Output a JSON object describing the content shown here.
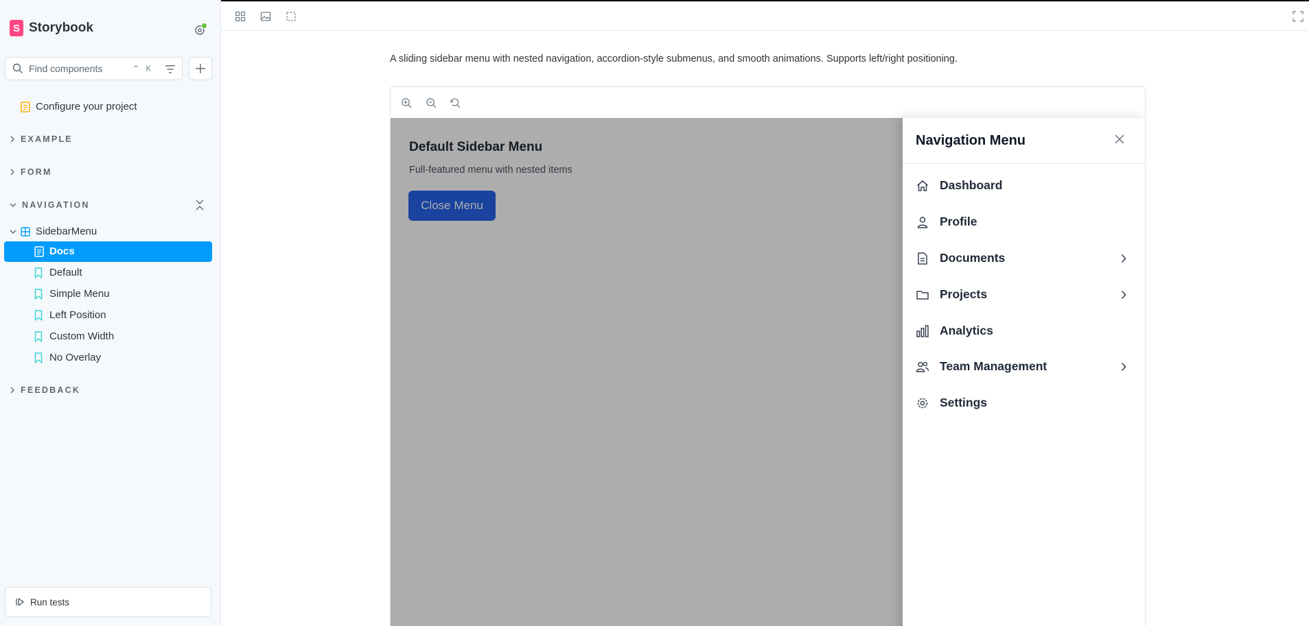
{
  "app": {
    "name": "Storybook"
  },
  "sidebar": {
    "search_placeholder": "Find components",
    "search_shortcut": "⌃ K",
    "configure": "Configure your project",
    "sections": {
      "example": "EXAMPLE",
      "form": "FORM",
      "navigation": "NAVIGATION",
      "feedback": "FEEDBACK"
    },
    "component": "SidebarMenu",
    "stories": [
      "Docs",
      "Default",
      "Simple Menu",
      "Left Position",
      "Custom Width",
      "No Overlay"
    ],
    "run_tests": "Run tests"
  },
  "doc": {
    "title": "SidebarMenu",
    "description": "A sliding sidebar menu with nested navigation, accordion-style submenus, and smooth animations. Supports left/right positioning."
  },
  "preview": {
    "demo_title": "Default Sidebar Menu",
    "demo_subtitle": "Full-featured menu with nested items",
    "demo_button": "Close Menu",
    "drawer_title": "Navigation Menu",
    "menu": [
      {
        "label": "Dashboard",
        "icon": "home-icon",
        "has_submenu": false
      },
      {
        "label": "Profile",
        "icon": "user-icon",
        "has_submenu": false
      },
      {
        "label": "Documents",
        "icon": "document-icon",
        "has_submenu": true
      },
      {
        "label": "Projects",
        "icon": "folder-icon",
        "has_submenu": true
      },
      {
        "label": "Analytics",
        "icon": "bar-chart-icon",
        "has_submenu": false
      },
      {
        "label": "Team Management",
        "icon": "users-icon",
        "has_submenu": true
      },
      {
        "label": "Settings",
        "icon": "gear-icon",
        "has_submenu": false
      }
    ]
  },
  "colors": {
    "accent": "#029cfd",
    "brand": "#ff4785",
    "button": "#2563eb",
    "story_icon": "#37d5d3",
    "docs_icon": "#ffae00"
  }
}
